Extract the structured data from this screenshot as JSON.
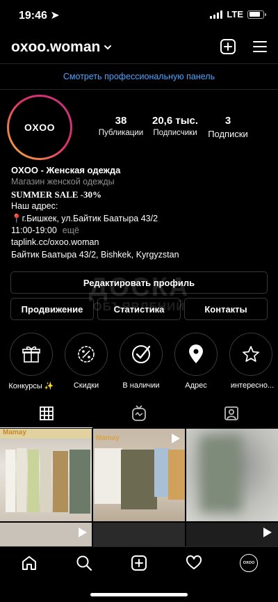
{
  "status_bar": {
    "time": "19:46",
    "network": "LTE"
  },
  "header": {
    "username": "oxoo.woman",
    "pro_panel": "Смотреть профессиональную панель"
  },
  "avatar": {
    "text": "OXOO"
  },
  "stats": [
    {
      "value": "38",
      "label": "Публикации"
    },
    {
      "value": "20,6 тыс.",
      "label": "Подписчики"
    },
    {
      "value": "3",
      "label": "Подписки"
    }
  ],
  "bio": {
    "name": "OXOO - Женская одежда",
    "category": "Магазин женской одежды",
    "sale": "SUMMER SALE -30%",
    "address_label": "Наш адрес:",
    "address_line": "📍г.Бишкек, ул.Байтик Баатыра 43/2",
    "hours": "11:00-19:00",
    "more": "ещё",
    "link": "taplink.cc/oxoo.woman",
    "location": "Байтик Баатыра 43/2, Bishkek, Kyrgyzstan"
  },
  "buttons": {
    "edit_profile": "Редактировать профиль",
    "promotion": "Продвижение",
    "statistics": "Статистика",
    "contacts": "Контакты"
  },
  "highlights": [
    {
      "label": "Конкурсы ✨",
      "icon": "gift-icon"
    },
    {
      "label": "Скидки",
      "icon": "percent-badge-icon"
    },
    {
      "label": "В наличии",
      "icon": "check-compass-icon"
    },
    {
      "label": "Адрес",
      "icon": "location-pin-icon"
    },
    {
      "label": "интересно...",
      "icon": "star-icon"
    }
  ],
  "watermark": {
    "line1": "ДОСКА",
    "line2": "ОБЪЯВЛЕНИЙ"
  },
  "posts": [
    {
      "caption": "Mamay"
    },
    {
      "caption": "Mamay"
    }
  ],
  "colors": {
    "link": "#4aa3ff",
    "secondary_text": "#8e8e8e",
    "border": "#363636"
  }
}
